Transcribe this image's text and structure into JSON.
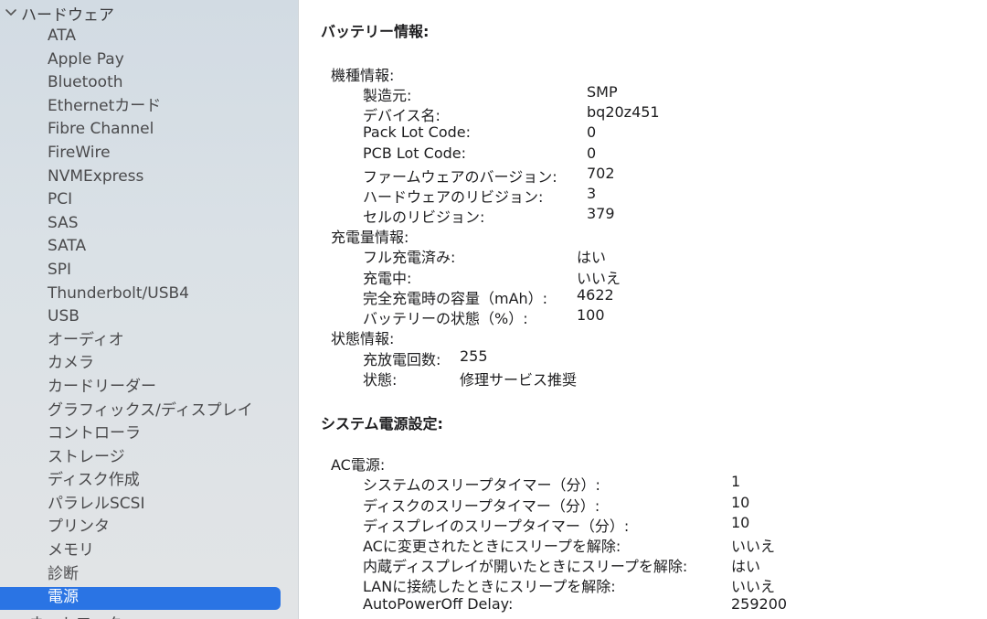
{
  "sidebar": {
    "header": "ハードウェア",
    "items": [
      {
        "label": "ATA"
      },
      {
        "label": "Apple Pay"
      },
      {
        "label": "Bluetooth"
      },
      {
        "label": "Ethernetカード"
      },
      {
        "label": "Fibre Channel"
      },
      {
        "label": "FireWire"
      },
      {
        "label": "NVMExpress"
      },
      {
        "label": "PCI"
      },
      {
        "label": "SAS"
      },
      {
        "label": "SATA"
      },
      {
        "label": "SPI"
      },
      {
        "label": "Thunderbolt/USB4"
      },
      {
        "label": "USB"
      },
      {
        "label": "オーディオ"
      },
      {
        "label": "カメラ"
      },
      {
        "label": "カードリーダー"
      },
      {
        "label": "グラフィックス/ディスプレイ"
      },
      {
        "label": "コントローラ"
      },
      {
        "label": "ストレージ"
      },
      {
        "label": "ディスク作成"
      },
      {
        "label": "パラレルSCSI"
      },
      {
        "label": "プリンタ"
      },
      {
        "label": "メモリ"
      },
      {
        "label": "診断"
      },
      {
        "label": "電源",
        "selected": true
      }
    ],
    "partial_item": "ネットワーク"
  },
  "battery": {
    "title": "バッテリー情報:",
    "model_info": {
      "title": "機種情報:",
      "rows": [
        {
          "k": "製造元:",
          "v": "SMP"
        },
        {
          "k": "デバイス名:",
          "v": "bq20z451"
        },
        {
          "k": "Pack Lot Code:",
          "v": "0"
        },
        {
          "k": "PCB Lot Code:",
          "v": "0"
        },
        {
          "k": "ファームウェアのバージョン:",
          "v": "702"
        },
        {
          "k": "ハードウェアのリビジョン:",
          "v": "3"
        },
        {
          "k": "セルのリビジョン:",
          "v": "379"
        }
      ]
    },
    "charge_info": {
      "title": "充電量情報:",
      "rows": [
        {
          "k": "フル充電済み:",
          "v": "はい"
        },
        {
          "k": "充電中:",
          "v": "いいえ"
        },
        {
          "k": "完全充電時の容量（mAh）:",
          "v": "4622"
        },
        {
          "k": "バッテリーの状態（%）:",
          "v": "100"
        }
      ]
    },
    "health_info": {
      "title": "状態情報:",
      "rows": [
        {
          "k": "充放電回数:",
          "v": "255"
        },
        {
          "k": "状態:",
          "v": "修理サービス推奨"
        }
      ]
    }
  },
  "power_settings": {
    "title": "システム電源設定:",
    "ac_power": {
      "title": "AC電源:",
      "rows": [
        {
          "k": "システムのスリープタイマー（分）:",
          "v": "1"
        },
        {
          "k": "ディスクのスリープタイマー（分）:",
          "v": "10"
        },
        {
          "k": "ディスプレイのスリープタイマー（分）:",
          "v": "10"
        },
        {
          "k": "ACに変更されたときにスリープを解除:",
          "v": "いいえ"
        },
        {
          "k": "内蔵ディスプレイが開いたときにスリープを解除:",
          "v": "はい"
        },
        {
          "k": "LANに接続したときにスリープを解除:",
          "v": "いいえ"
        },
        {
          "k": "AutoPowerOff Delay:",
          "v": "259200"
        }
      ]
    }
  },
  "colors": {
    "selection": "#2a74e4",
    "sidebar_bg": "#d6dee4"
  }
}
